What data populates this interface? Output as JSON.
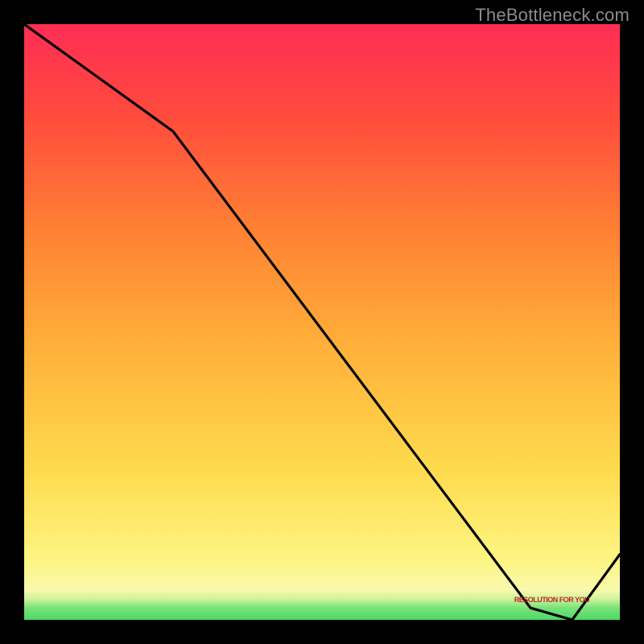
{
  "watermark": "TheBottleneck.com",
  "annotation_label": "RESOLUTION FOR YOU",
  "chart_data": {
    "type": "line",
    "title": "",
    "xlabel": "",
    "ylabel": "",
    "xlim": [
      0,
      100
    ],
    "ylim": [
      0,
      100
    ],
    "x": [
      0,
      25,
      85,
      92,
      100
    ],
    "values": [
      100,
      82,
      2,
      0,
      11
    ],
    "optimal_x": 92,
    "annotation": "RESOLUTION FOR YOU",
    "gradient_stops": [
      {
        "offset": 0.0,
        "color": "#4fd866"
      },
      {
        "offset": 0.02,
        "color": "#77e37a"
      },
      {
        "offset": 0.035,
        "color": "#d0f29a"
      },
      {
        "offset": 0.05,
        "color": "#f9f9ad"
      },
      {
        "offset": 0.1,
        "color": "#fdf582"
      },
      {
        "offset": 0.25,
        "color": "#fedb4e"
      },
      {
        "offset": 0.45,
        "color": "#ffb23a"
      },
      {
        "offset": 0.65,
        "color": "#ff8233"
      },
      {
        "offset": 0.85,
        "color": "#ff4a3d"
      },
      {
        "offset": 1.0,
        "color": "#ff2d55"
      }
    ]
  }
}
